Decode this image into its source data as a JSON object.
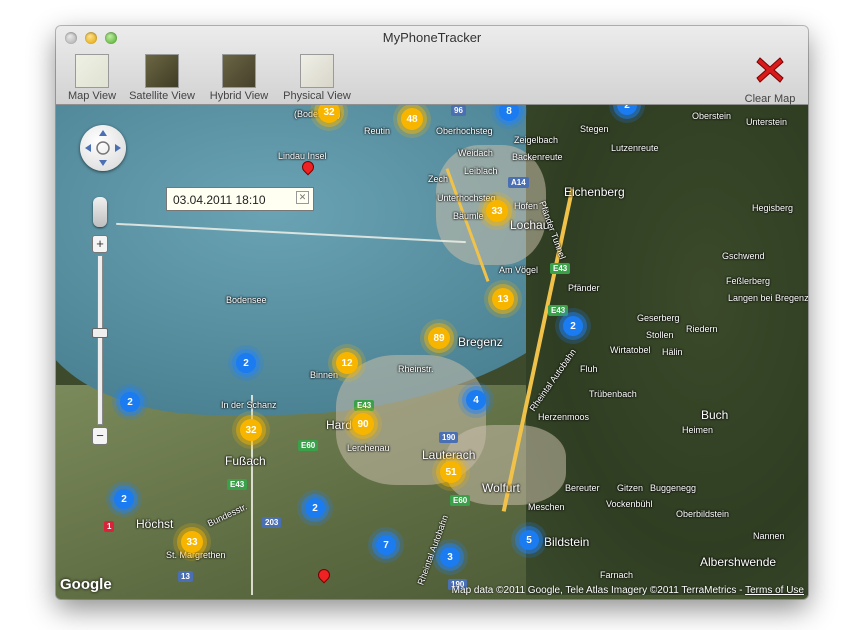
{
  "window": {
    "title": "MyPhoneTracker"
  },
  "toolbar": {
    "map_view": "Map View",
    "satellite_view": "Satellite View",
    "hybrid_view": "Hybrid View",
    "physical_view": "Physical View",
    "clear_map": "Clear Map"
  },
  "info_window": {
    "text": "03.04.2011 18:10"
  },
  "clusters": [
    "32",
    "48",
    "8",
    "2",
    "33",
    "13",
    "2",
    "89",
    "12",
    "2",
    "2",
    "4",
    "32",
    "90",
    "51",
    "2",
    "33",
    "2",
    "7",
    "3",
    "5"
  ],
  "places": [
    "(Bodensee)",
    "Reutin",
    "Oberhochsteg",
    "Zeigelbach",
    "Weidach",
    "Backenreute",
    "Lindau Insel",
    "Zech",
    "Leiblach",
    "Eichenberg",
    "Unterhochsteg",
    "Hofen",
    "Lochau",
    "Bäumle",
    "Am Vögel",
    "Pfänder",
    "Bodensee",
    "Bregenz",
    "Geserberg",
    "Langen bei Bregenz",
    "Stollen",
    "Riedern",
    "Wirtatobel",
    "Hälin",
    "Binnen",
    "Rheinstr.",
    "Fluh",
    "Trübenbach",
    "Hard",
    "Lerchenau",
    "Herzenmoos",
    "Buch",
    "Heimen",
    "In der Schanz",
    "Fußach",
    "Lauterach",
    "Wolfurt",
    "Bereuter",
    "Gitzen",
    "Buggenegg",
    "Höchst",
    "Vockenbühl",
    "Oberbildstein",
    "Meschen",
    "Bildstein",
    "Nannen",
    "St. Margrethen",
    "Farnach",
    "Albershwende",
    "Stegen",
    "Oberstein",
    "Unterstein",
    "Lutzenreute",
    "Hegisberg",
    "Gschwend",
    "Feßlerberg"
  ],
  "shields": [
    "96",
    "A14",
    "E43",
    "E43",
    "E43",
    "190",
    "E60",
    "E43",
    "E60",
    "203",
    "13",
    "1",
    "190"
  ],
  "roads": [
    "Pfänder Tunnel",
    "Rheintal Autobahn",
    "Rheintal Autobahn",
    "Bundesstr."
  ],
  "map_brand": "Google",
  "attribution": "Map data ©2011 Google, Tele Atlas Imagery ©2011 TerraMetrics - ",
  "terms": "Terms of Use"
}
